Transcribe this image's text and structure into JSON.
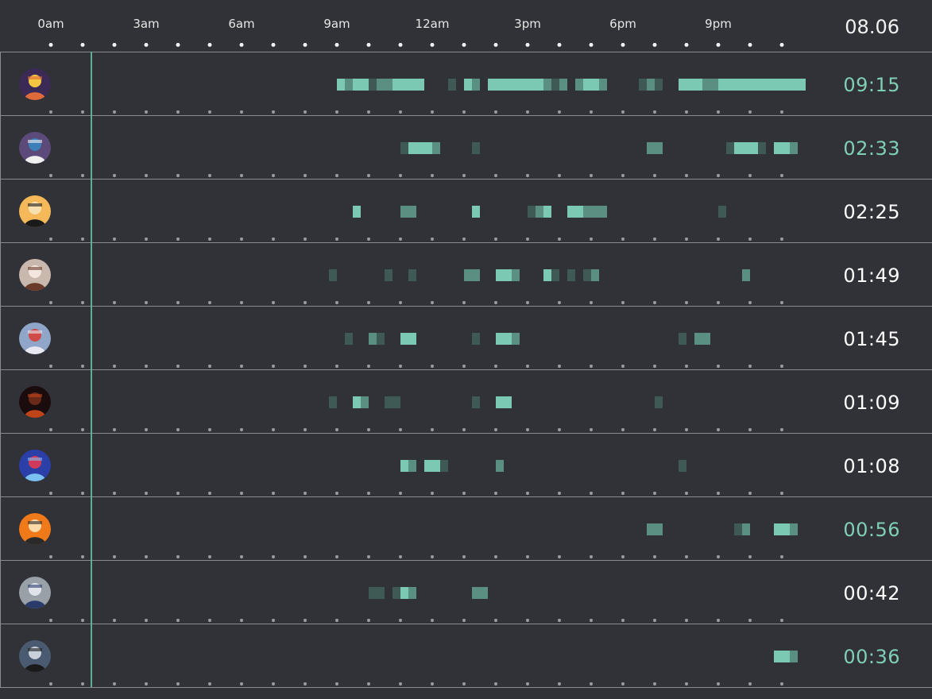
{
  "header": {
    "hours": [
      "0am",
      "3am",
      "6am",
      "9am",
      "12am",
      "3pm",
      "6pm",
      "9pm"
    ],
    "date": "08.06"
  },
  "colors": {
    "background": "#313237",
    "full": "#7bc8b3",
    "medium": "#5a8f81",
    "low": "#3f5a55",
    "highlight_total": "#7fcfb6",
    "normal_total": "#ffffff",
    "now_line": "#5fae93"
  },
  "rows": [
    {
      "avatar": "user-avatar-1",
      "total": "09:15",
      "highlight": true,
      "cells": [
        [
          31,
          2
        ],
        [
          32,
          1
        ],
        [
          33,
          2
        ],
        [
          34,
          2
        ],
        [
          35,
          0
        ],
        [
          36,
          1
        ],
        [
          37,
          1
        ],
        [
          38,
          2
        ],
        [
          39,
          2
        ],
        [
          40,
          2
        ],
        [
          41,
          2
        ],
        [
          45,
          0
        ],
        [
          47,
          2
        ],
        [
          48,
          1
        ],
        [
          50,
          2
        ],
        [
          51,
          2
        ],
        [
          52,
          2
        ],
        [
          53,
          2
        ],
        [
          54,
          2
        ],
        [
          55,
          2
        ],
        [
          56,
          2
        ],
        [
          57,
          1
        ],
        [
          58,
          0
        ],
        [
          59,
          1
        ],
        [
          61,
          1
        ],
        [
          62,
          2
        ],
        [
          63,
          2
        ],
        [
          64,
          1
        ],
        [
          69,
          0
        ],
        [
          70,
          1
        ],
        [
          71,
          0
        ],
        [
          74,
          2
        ],
        [
          75,
          2
        ],
        [
          76,
          2
        ],
        [
          77,
          1
        ],
        [
          78,
          1
        ],
        [
          79,
          2
        ],
        [
          80,
          2
        ],
        [
          81,
          2
        ],
        [
          82,
          2
        ],
        [
          83,
          2
        ],
        [
          84,
          2
        ],
        [
          85,
          2
        ],
        [
          86,
          2
        ],
        [
          87,
          2
        ],
        [
          88,
          2
        ],
        [
          89,
          2
        ]
      ]
    },
    {
      "avatar": "user-avatar-2",
      "total": "02:33",
      "highlight": true,
      "cells": [
        [
          39,
          0
        ],
        [
          40,
          2
        ],
        [
          41,
          2
        ],
        [
          42,
          2
        ],
        [
          43,
          1
        ],
        [
          48,
          0
        ],
        [
          70,
          1
        ],
        [
          71,
          1
        ],
        [
          80,
          0
        ],
        [
          81,
          2
        ],
        [
          82,
          2
        ],
        [
          83,
          2
        ],
        [
          84,
          0
        ],
        [
          86,
          2
        ],
        [
          87,
          2
        ],
        [
          88,
          1
        ]
      ]
    },
    {
      "avatar": "user-avatar-3",
      "total": "02:25",
      "highlight": false,
      "cells": [
        [
          33,
          2
        ],
        [
          39,
          1
        ],
        [
          40,
          1
        ],
        [
          48,
          2
        ],
        [
          55,
          0
        ],
        [
          56,
          1
        ],
        [
          57,
          2
        ],
        [
          60,
          2
        ],
        [
          61,
          2
        ],
        [
          62,
          1
        ],
        [
          63,
          1
        ],
        [
          64,
          1
        ],
        [
          79,
          0
        ]
      ]
    },
    {
      "avatar": "user-avatar-4",
      "total": "01:49",
      "highlight": false,
      "cells": [
        [
          30,
          0
        ],
        [
          37,
          0
        ],
        [
          40,
          0
        ],
        [
          47,
          1
        ],
        [
          48,
          1
        ],
        [
          51,
          2
        ],
        [
          52,
          2
        ],
        [
          53,
          1
        ],
        [
          57,
          2
        ],
        [
          58,
          0
        ],
        [
          60,
          0
        ],
        [
          62,
          0
        ],
        [
          63,
          1
        ],
        [
          82,
          1
        ]
      ]
    },
    {
      "avatar": "user-avatar-5",
      "total": "01:45",
      "highlight": false,
      "cells": [
        [
          32,
          0
        ],
        [
          35,
          1
        ],
        [
          36,
          0
        ],
        [
          39,
          2
        ],
        [
          40,
          2
        ],
        [
          48,
          0
        ],
        [
          51,
          2
        ],
        [
          52,
          2
        ],
        [
          53,
          1
        ],
        [
          74,
          0
        ],
        [
          76,
          1
        ],
        [
          77,
          1
        ]
      ]
    },
    {
      "avatar": "user-avatar-6",
      "total": "01:09",
      "highlight": false,
      "cells": [
        [
          30,
          0
        ],
        [
          33,
          2
        ],
        [
          34,
          1
        ],
        [
          37,
          0
        ],
        [
          38,
          0
        ],
        [
          48,
          0
        ],
        [
          51,
          2
        ],
        [
          52,
          2
        ],
        [
          71,
          0
        ]
      ]
    },
    {
      "avatar": "user-avatar-7",
      "total": "01:08",
      "highlight": false,
      "cells": [
        [
          39,
          2
        ],
        [
          40,
          1
        ],
        [
          42,
          2
        ],
        [
          43,
          2
        ],
        [
          44,
          0
        ],
        [
          51,
          1
        ],
        [
          74,
          0
        ]
      ]
    },
    {
      "avatar": "user-avatar-8",
      "total": "00:56",
      "highlight": true,
      "cells": [
        [
          70,
          1
        ],
        [
          71,
          1
        ],
        [
          81,
          0
        ],
        [
          82,
          1
        ],
        [
          86,
          2
        ],
        [
          87,
          2
        ],
        [
          88,
          1
        ]
      ]
    },
    {
      "avatar": "user-avatar-9",
      "total": "00:42",
      "highlight": false,
      "cells": [
        [
          35,
          0
        ],
        [
          36,
          0
        ],
        [
          38,
          0
        ],
        [
          39,
          2
        ],
        [
          40,
          1
        ],
        [
          48,
          1
        ],
        [
          49,
          1
        ]
      ]
    },
    {
      "avatar": "user-avatar-10",
      "total": "00:36",
      "highlight": true,
      "cells": [
        [
          86,
          2
        ],
        [
          87,
          2
        ],
        [
          88,
          1
        ]
      ]
    }
  ]
}
